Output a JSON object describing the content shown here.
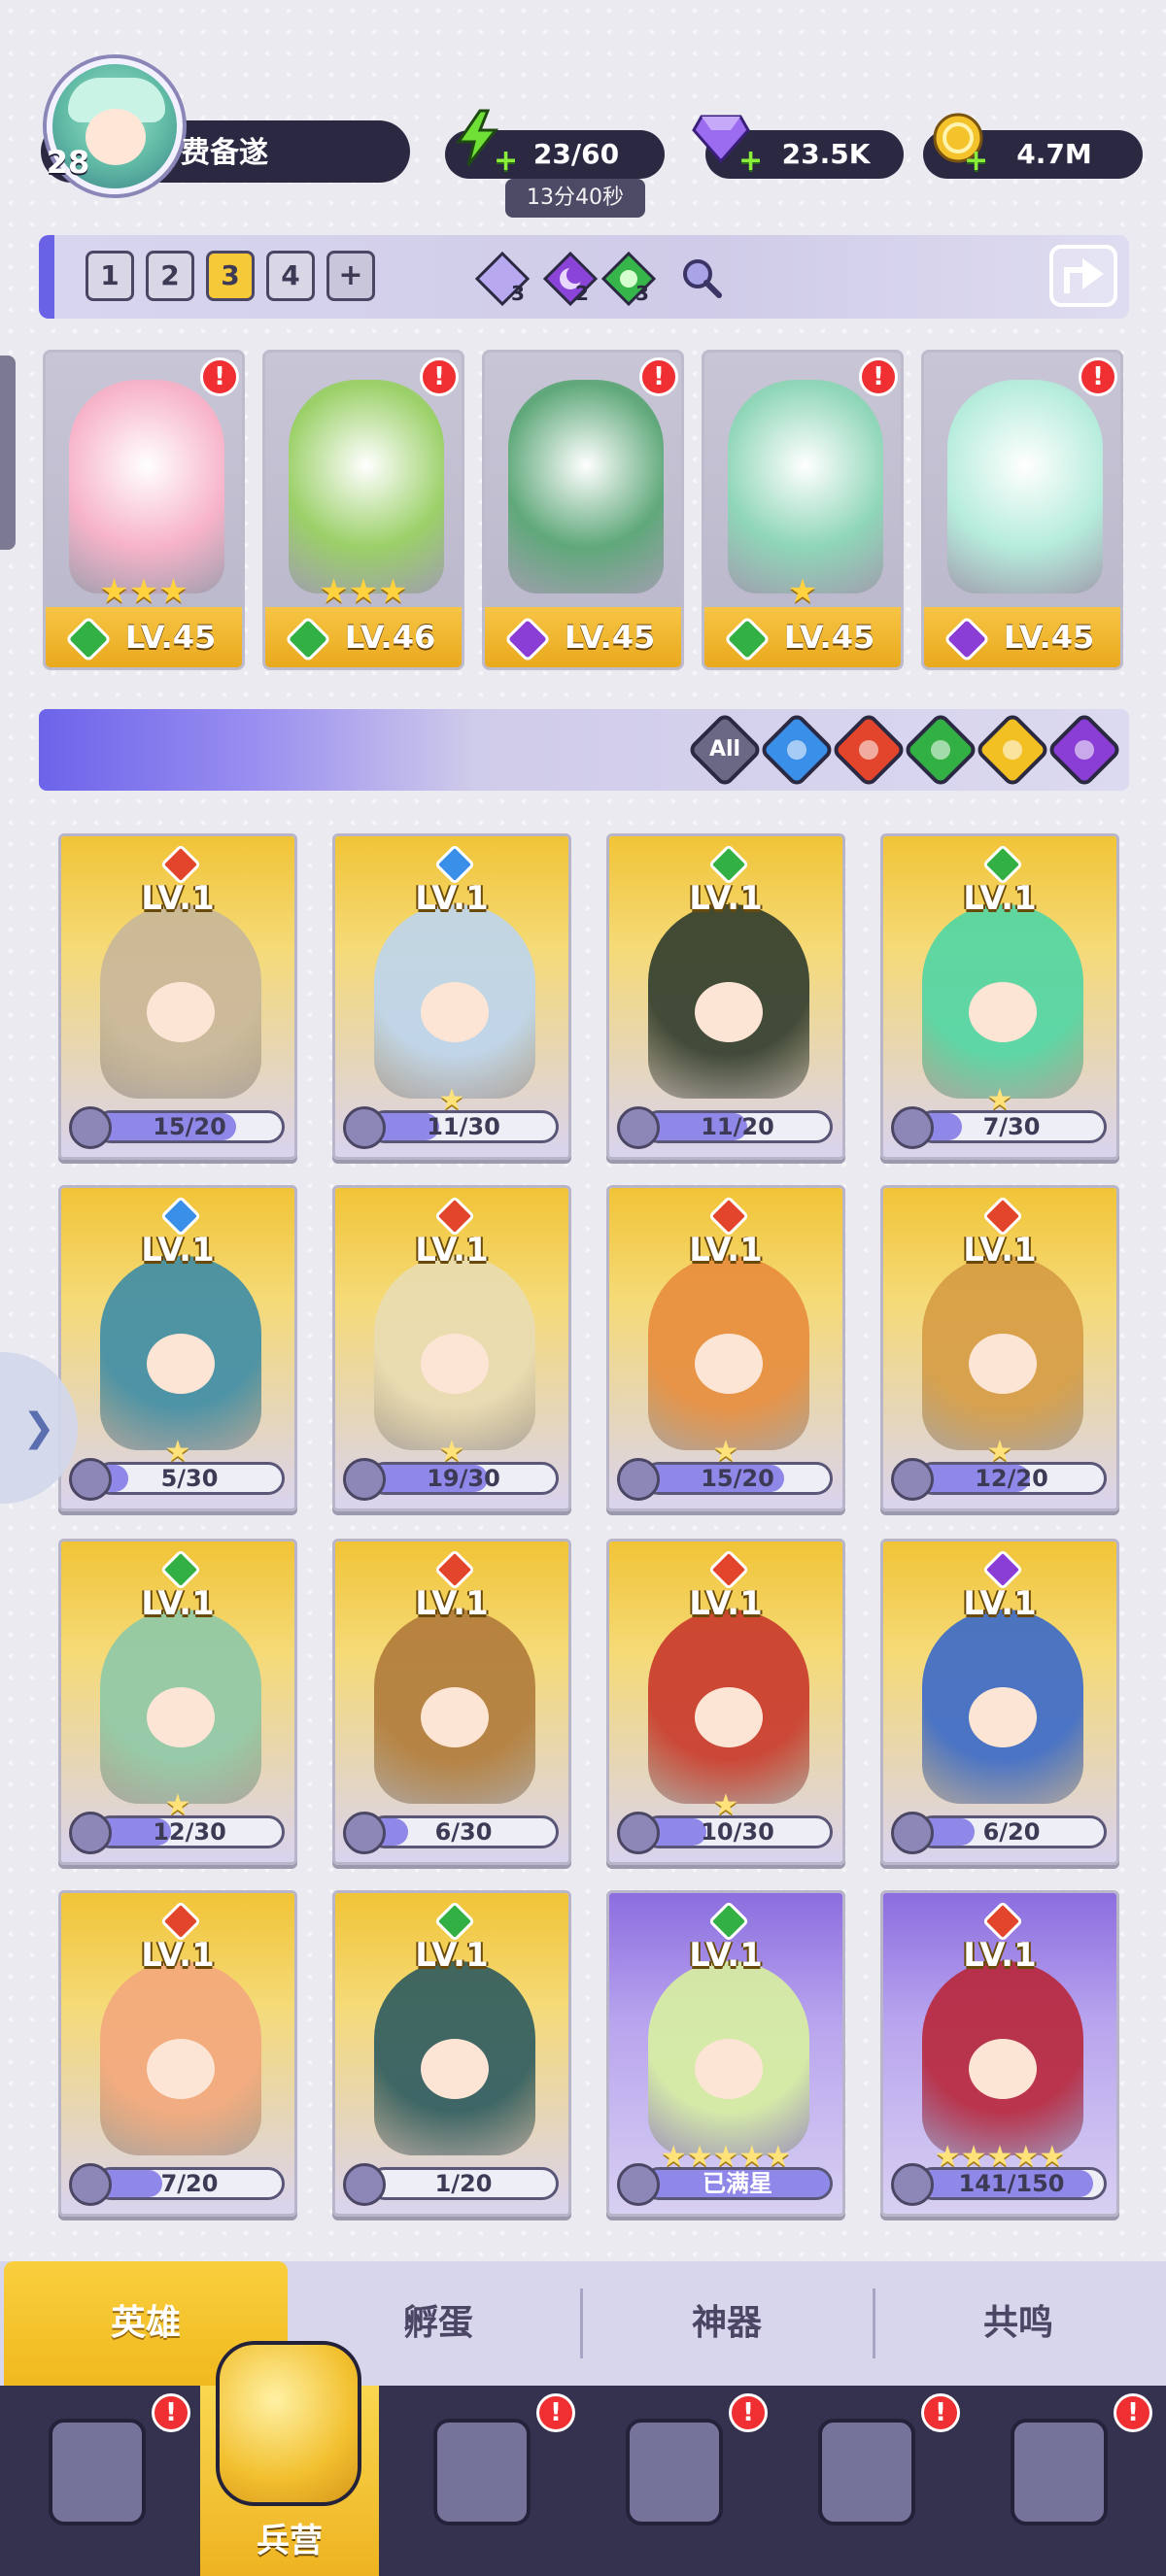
{
  "player": {
    "level": "28",
    "name": "费备遂"
  },
  "resources": [
    {
      "name": "stamina",
      "icon": "lightning-icon",
      "value": "23/60",
      "timer": "13分40秒",
      "color": "#6fe036"
    },
    {
      "name": "gems",
      "icon": "diamond-icon",
      "value": "23.5K",
      "color": "#9c6cf0"
    },
    {
      "name": "gold",
      "icon": "coin-icon",
      "value": "4.7M",
      "color": "#f4c22b"
    }
  ],
  "team_tabs": {
    "items": [
      "1",
      "2",
      "3",
      "4",
      "+"
    ],
    "active": "3"
  },
  "team_elements": [
    {
      "icon": "water-gem-icon",
      "count": "3",
      "color": "#b8a8f0"
    },
    {
      "icon": "moon-gem-icon",
      "count": "2",
      "color": "#8a44d8"
    },
    {
      "icon": "nature-gem-icon",
      "count": "3",
      "color": "#36b54a"
    }
  ],
  "team": [
    {
      "level": "LV.45",
      "stars": "★★★",
      "element": "nature",
      "color": "#f7b3c9"
    },
    {
      "level": "LV.46",
      "stars": "★★★",
      "element": "nature",
      "color": "#9bd068"
    },
    {
      "level": "LV.45",
      "stars": "",
      "element": "dark",
      "color": "#5fa87a"
    },
    {
      "level": "LV.45",
      "stars": "★",
      "element": "nature",
      "color": "#8fd6b8"
    },
    {
      "level": "LV.45",
      "stars": "",
      "element": "dark",
      "color": "#b6ecdc"
    }
  ],
  "filters": [
    {
      "name": "all",
      "label": "All",
      "color": "#6b6886"
    },
    {
      "name": "water",
      "icon": "water-drop-icon",
      "color": "#3a8fe8"
    },
    {
      "name": "fire",
      "icon": "flame-icon",
      "color": "#e2452b"
    },
    {
      "name": "nature",
      "icon": "leaf-icon",
      "color": "#33b043"
    },
    {
      "name": "light",
      "icon": "star-sparkle-icon",
      "color": "#f3c024"
    },
    {
      "name": "dark",
      "icon": "moon-icon",
      "color": "#8b3ed6"
    }
  ],
  "heroes": [
    {
      "level": "LV.1",
      "element": "fire",
      "shards": "15/20",
      "fill": 0.75,
      "stars": "",
      "color": "#c8b79a"
    },
    {
      "level": "LV.1",
      "element": "water",
      "shards": "11/30",
      "fill": 0.37,
      "stars": "★",
      "color": "#bcd5ee"
    },
    {
      "level": "LV.1",
      "element": "nature",
      "shards": "11/20",
      "fill": 0.55,
      "stars": "",
      "color": "#2f3b2d"
    },
    {
      "level": "LV.1",
      "element": "nature",
      "shards": "7/30",
      "fill": 0.23,
      "stars": "★",
      "color": "#4fd6a5"
    },
    {
      "level": "LV.1",
      "element": "water",
      "shards": "5/30",
      "fill": 0.17,
      "stars": "★",
      "color": "#3d8ca6"
    },
    {
      "level": "LV.1",
      "element": "fire",
      "shards": "19/30",
      "fill": 0.63,
      "stars": "★",
      "color": "#e9dcb2"
    },
    {
      "level": "LV.1",
      "element": "fire",
      "shards": "15/20",
      "fill": 0.75,
      "stars": "★",
      "color": "#e88c3c"
    },
    {
      "level": "LV.1",
      "element": "fire",
      "shards": "12/20",
      "fill": 0.6,
      "stars": "★",
      "color": "#d69b43"
    },
    {
      "level": "LV.1",
      "element": "nature",
      "shards": "12/30",
      "fill": 0.4,
      "stars": "★",
      "color": "#8ec9a8"
    },
    {
      "level": "LV.1",
      "element": "fire",
      "shards": "6/30",
      "fill": 0.2,
      "stars": "",
      "color": "#b07a3a"
    },
    {
      "level": "LV.1",
      "element": "fire",
      "shards": "10/30",
      "fill": 0.33,
      "stars": "★",
      "color": "#c8382b"
    },
    {
      "level": "LV.1",
      "element": "dark",
      "shards": "6/20",
      "fill": 0.3,
      "stars": "",
      "color": "#3a69c8"
    },
    {
      "level": "LV.1",
      "element": "fire",
      "shards": "7/20",
      "fill": 0.35,
      "stars": "",
      "color": "#f3a77c"
    },
    {
      "level": "LV.1",
      "element": "nature",
      "shards": "1/20",
      "fill": 0.05,
      "stars": "",
      "color": "#2c5a5e"
    },
    {
      "level": "LV.1",
      "element": "nature",
      "shards": "已满星",
      "fill": 1.0,
      "stars": "★★★★★",
      "color": "#d8f0a0",
      "purple": true,
      "full": true
    },
    {
      "level": "LV.1",
      "element": "fire",
      "shards": "141/150",
      "fill": 0.94,
      "stars": "★★★★★",
      "color": "#b8263a",
      "purple": true
    }
  ],
  "sub_tabs": [
    "英雄",
    "孵蛋",
    "神器",
    "共鸣"
  ],
  "nav": [
    {
      "name": "cards",
      "icon": "cards-icon",
      "alert": true
    },
    {
      "name": "barracks",
      "icon": "helmet-icon",
      "label": "兵营",
      "active": true
    },
    {
      "name": "adventure",
      "icon": "map-book-icon",
      "alert": true
    },
    {
      "name": "castle",
      "icon": "castle-icon",
      "alert": true
    },
    {
      "name": "guild",
      "icon": "mushroom-house-icon",
      "alert": true
    },
    {
      "name": "banner",
      "icon": "banner-icon",
      "alert": true
    }
  ],
  "colors": {
    "fire": "#e2452b",
    "water": "#3a8fe8",
    "nature": "#33b043",
    "dark": "#8b3ed6",
    "light": "#f3c024",
    "alert": "#ef2f32"
  }
}
